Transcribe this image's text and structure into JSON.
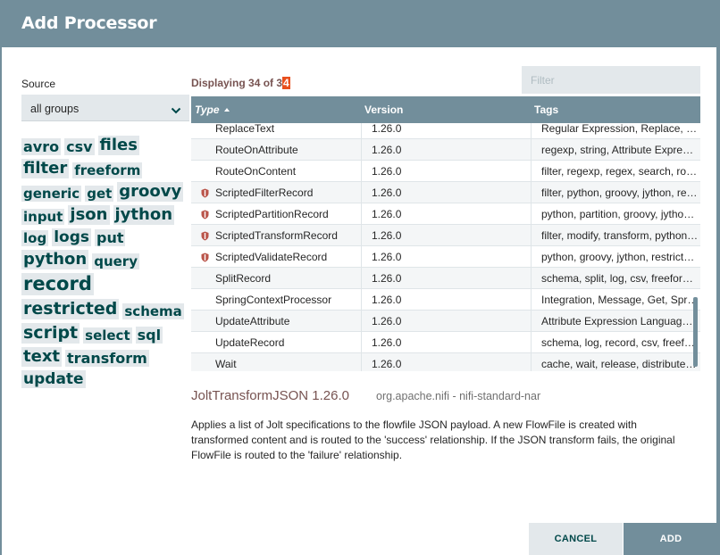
{
  "dialog": {
    "title": "Add Processor"
  },
  "source": {
    "label": "Source",
    "selected": "all groups"
  },
  "tags": [
    {
      "label": "avro",
      "size": 16
    },
    {
      "label": "csv",
      "size": 16
    },
    {
      "label": "files",
      "size": 18
    },
    {
      "label": "filter",
      "size": 18
    },
    {
      "label": "freeform",
      "size": 15
    },
    {
      "label": "generic",
      "size": 15
    },
    {
      "label": "get",
      "size": 15
    },
    {
      "label": "groovy",
      "size": 18
    },
    {
      "label": "input",
      "size": 15
    },
    {
      "label": "json",
      "size": 18
    },
    {
      "label": "jython",
      "size": 18
    },
    {
      "label": "log",
      "size": 15
    },
    {
      "label": "logs",
      "size": 17
    },
    {
      "label": "put",
      "size": 16
    },
    {
      "label": "python",
      "size": 18
    },
    {
      "label": "query",
      "size": 15
    },
    {
      "label": "record",
      "size": 21
    },
    {
      "label": "restricted",
      "size": 19
    },
    {
      "label": "schema",
      "size": 15
    },
    {
      "label": "script",
      "size": 19
    },
    {
      "label": "select",
      "size": 15
    },
    {
      "label": "sql",
      "size": 16
    },
    {
      "label": "text",
      "size": 18
    },
    {
      "label": "transform",
      "size": 16
    },
    {
      "label": "update",
      "size": 17
    }
  ],
  "displaying": {
    "prefix": "Displaying 34 of 3",
    "highlight": "4"
  },
  "filter": {
    "placeholder": "Filter",
    "value": ""
  },
  "table": {
    "columns": {
      "type": "Type",
      "version": "Version",
      "tags": "Tags"
    },
    "sort": "Type ascending",
    "rows": [
      {
        "type": "ReplaceText",
        "version": "1.26.0",
        "tags": "Regular Expression, Replace, R…",
        "restricted": false
      },
      {
        "type": "RouteOnAttribute",
        "version": "1.26.0",
        "tags": "regexp, string, Attribute Express…",
        "restricted": false
      },
      {
        "type": "RouteOnContent",
        "version": "1.26.0",
        "tags": "filter, regexp, regex, search, rout…",
        "restricted": false
      },
      {
        "type": "ScriptedFilterRecord",
        "version": "1.26.0",
        "tags": "filter, python, groovy, jython, rest…",
        "restricted": true
      },
      {
        "type": "ScriptedPartitionRecord",
        "version": "1.26.0",
        "tags": "python, partition, groovy, jython,…",
        "restricted": true
      },
      {
        "type": "ScriptedTransformRecord",
        "version": "1.26.0",
        "tags": "filter, modify, transform, python,…",
        "restricted": true
      },
      {
        "type": "ScriptedValidateRecord",
        "version": "1.26.0",
        "tags": "python, groovy, jython, restricte…",
        "restricted": true
      },
      {
        "type": "SplitRecord",
        "version": "1.26.0",
        "tags": "schema, split, log, csv, freeform…",
        "restricted": false
      },
      {
        "type": "SpringContextProcessor",
        "version": "1.26.0",
        "tags": "Integration, Message, Get, Sprin…",
        "restricted": false
      },
      {
        "type": "UpdateAttribute",
        "version": "1.26.0",
        "tags": "Attribute Expression Language, …",
        "restricted": false
      },
      {
        "type": "UpdateRecord",
        "version": "1.26.0",
        "tags": "schema, log, record, csv, freefor…",
        "restricted": false
      },
      {
        "type": "Wait",
        "version": "1.26.0",
        "tags": "cache, wait, release, distributed, …",
        "restricted": false
      }
    ]
  },
  "selected_processor": {
    "name": "JoltTransformJSON 1.26.0",
    "bundle": "org.apache.nifi - nifi-standard-nar",
    "description": "Applies a list of Jolt specifications to the flowfile JSON payload. A new FlowFile is created with transformed content and is routed to the 'success' relationship. If the JSON transform fails, the original FlowFile is routed to the 'failure' relationship."
  },
  "buttons": {
    "cancel": "CANCEL",
    "add": "ADD"
  },
  "icons": {
    "restricted": "shield-icon",
    "dropdown": "chevron-down-icon",
    "sort": "sort-ascending-icon"
  },
  "colors": {
    "header": "#728e9b",
    "accent": "#e84f1d",
    "tag_text": "#004849",
    "tag_bg": "#e3e8eb",
    "title_text": "#775351"
  }
}
